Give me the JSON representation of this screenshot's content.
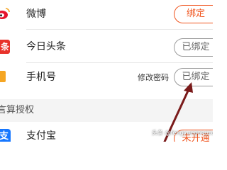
{
  "accounts": [
    {
      "name": "微博",
      "icon": "weibo-icon",
      "action": "绑定",
      "state": "unbound"
    },
    {
      "name": "今日头条",
      "icon": "toutiao-icon",
      "icon_text": "条",
      "action": "已绑定",
      "state": "bound"
    },
    {
      "name": "手机号",
      "icon": "phone-icon",
      "action": "已绑定",
      "state": "bound",
      "secondary_action": "修改密码"
    }
  ],
  "section": {
    "title": "第三方授权",
    "visible_title": "言算授权"
  },
  "authorizations": [
    {
      "name": "支付宝",
      "icon": "alipay-icon",
      "icon_text": "支",
      "action": "未开通",
      "state": "not-opened"
    }
  ],
  "watermark": "头条 @fengyuegongzuoshi",
  "colors": {
    "accent": "#f0541e",
    "weibo": "#e6162d",
    "toutiao": "#e8332b",
    "phone": "#f5a623",
    "alipay": "#1677ff",
    "arrow": "#7a1a1a",
    "section_bg": "#f4f4f4"
  }
}
